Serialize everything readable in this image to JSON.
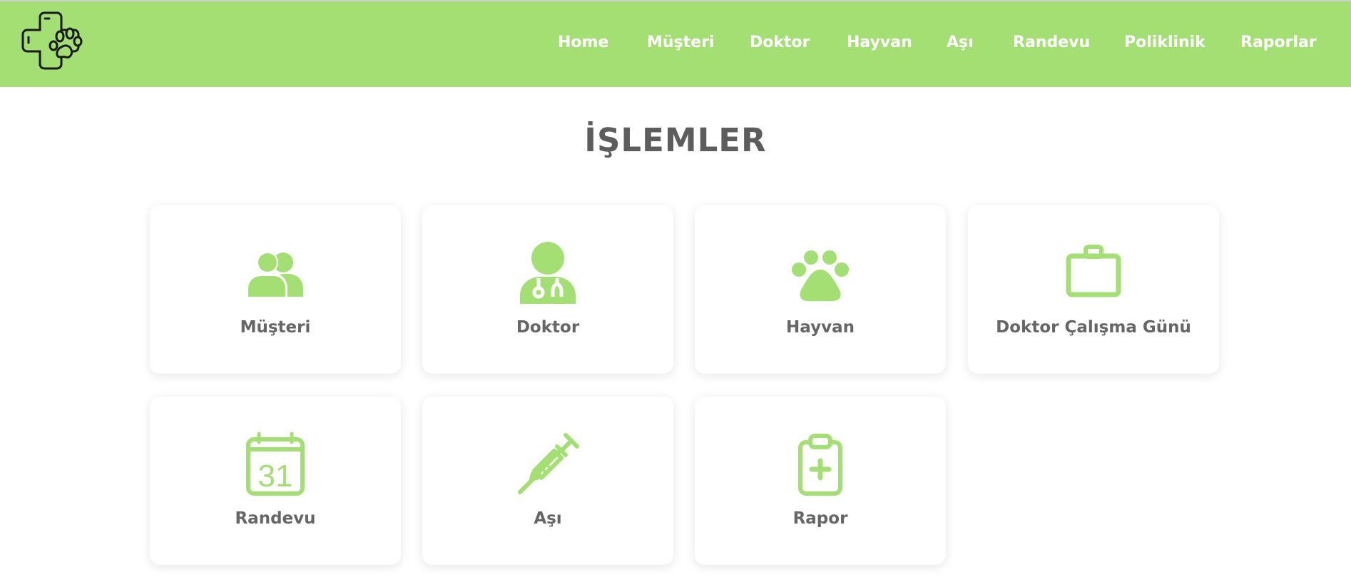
{
  "brand": {
    "accent": "#a4df74",
    "title_color": "#5d5d5d",
    "label_color": "#666666"
  },
  "logo": {
    "icon": "paw-cross-logo-icon"
  },
  "nav": {
    "items": [
      {
        "label": "Home"
      },
      {
        "label": "Müşteri"
      },
      {
        "label": "Doktor"
      },
      {
        "label": "Hayvan"
      },
      {
        "label": "Aşı"
      },
      {
        "label": "Randevu"
      },
      {
        "label": "Poliklinik"
      },
      {
        "label": "Raporlar"
      }
    ]
  },
  "page": {
    "title": "İŞLEMLER"
  },
  "cards": [
    {
      "label": "Müşteri",
      "icon": "users-icon"
    },
    {
      "label": "Doktor",
      "icon": "doctor-icon"
    },
    {
      "label": "Hayvan",
      "icon": "paw-icon"
    },
    {
      "label": "Doktor Çalışma Günü",
      "icon": "briefcase-icon"
    },
    {
      "label": "Randevu",
      "icon": "calendar-icon",
      "calendar_day": "31"
    },
    {
      "label": "Aşı",
      "icon": "syringe-icon"
    },
    {
      "label": "Rapor",
      "icon": "clipboard-plus-icon"
    }
  ]
}
